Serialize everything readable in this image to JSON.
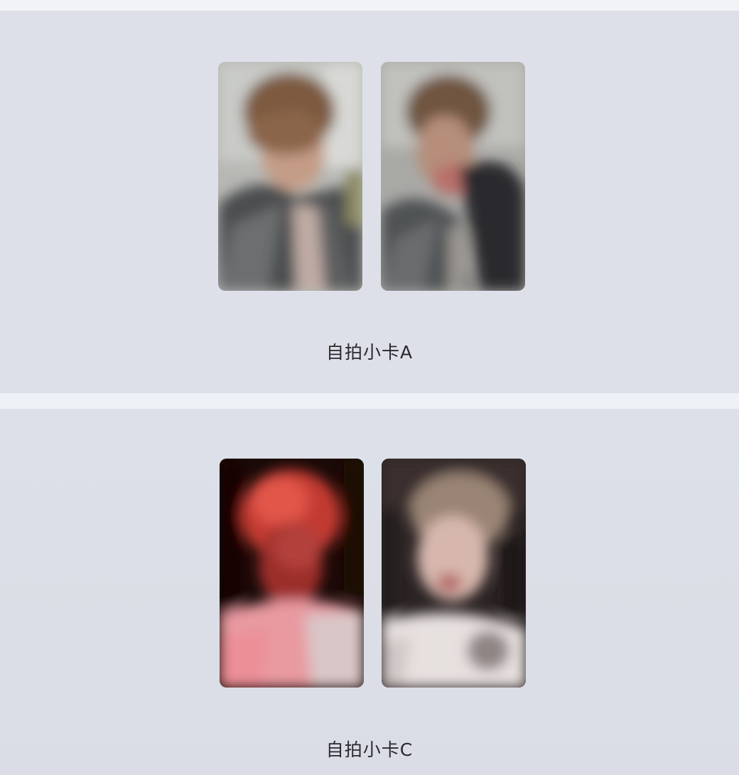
{
  "sections": [
    {
      "caption": "自拍小卡A",
      "cards": [
        {
          "name": "photocard-a-1",
          "palette": "grey-jacket"
        },
        {
          "name": "photocard-a-2",
          "palette": "grey-jacket-hand"
        }
      ]
    },
    {
      "caption": "自拍小卡C",
      "cards": [
        {
          "name": "photocard-c-1",
          "palette": "red-light"
        },
        {
          "name": "photocard-c-2",
          "palette": "pale-dark"
        }
      ]
    }
  ],
  "colors": {
    "panel_bg": "#dde0e8",
    "divider_bg": "#eef1f6",
    "caption_text": "#2a2a2e"
  }
}
